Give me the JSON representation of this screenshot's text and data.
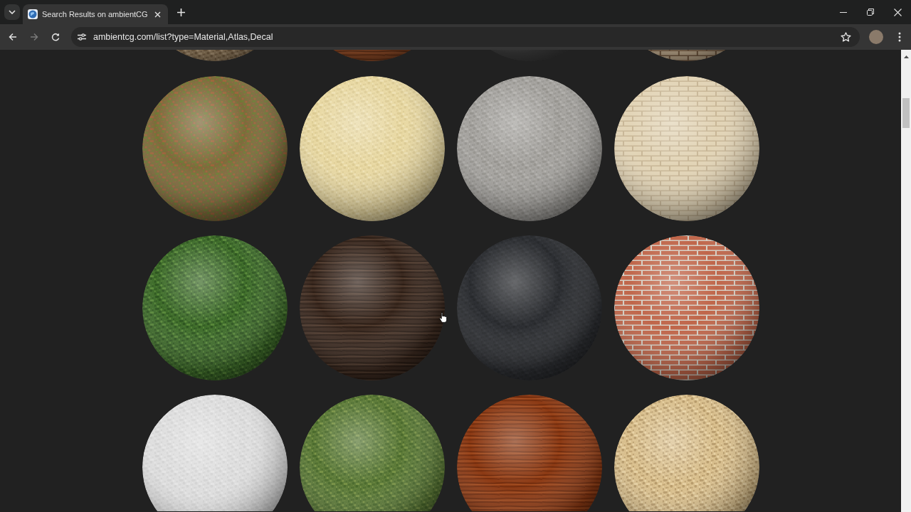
{
  "window": {
    "tabs": [
      {
        "title": "Search Results on ambientCG",
        "selected": true
      }
    ]
  },
  "toolbar": {
    "nav_buttons": [
      {
        "kind": "back",
        "disabled": false
      },
      {
        "kind": "forward",
        "disabled": true
      },
      {
        "kind": "reload",
        "disabled": false
      }
    ],
    "url": "ambientcg.com/list?type=Material,Atlas,Decal",
    "bookmarked": false
  }
}
